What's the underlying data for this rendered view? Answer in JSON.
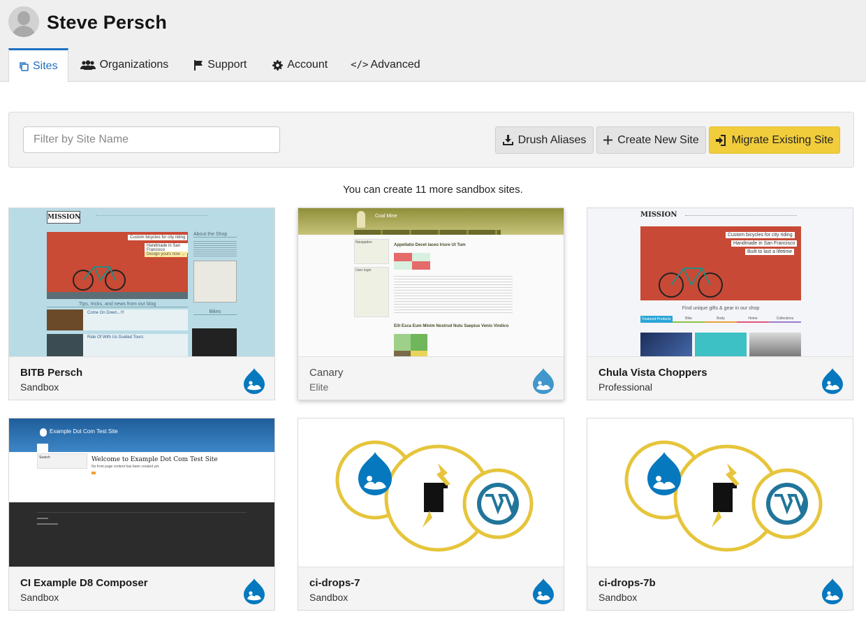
{
  "header": {
    "user_name": "Steve Persch",
    "tabs": [
      {
        "label": "Sites",
        "icon": "copy-icon",
        "active": true
      },
      {
        "label": "Organizations",
        "icon": "users-icon",
        "active": false
      },
      {
        "label": "Support",
        "icon": "flag-icon",
        "active": false
      },
      {
        "label": "Account",
        "icon": "gear-icon",
        "active": false
      },
      {
        "label": "Advanced",
        "icon": "code-icon",
        "active": false
      }
    ]
  },
  "toolbar": {
    "filter_placeholder": "Filter by Site Name",
    "filter_value": "",
    "drush_label": "Drush Aliases",
    "create_label": "Create New Site",
    "migrate_label": "Migrate Existing Site"
  },
  "sandbox_note": "You can create 11 more sandbox sites.",
  "colors": {
    "accent": "#1e6fbf",
    "migrate_button": "#f1cd3b",
    "drupal_blue": "#0678be",
    "migrate_ring": "#e6c53c"
  },
  "sites": [
    {
      "name": "BITB Persch",
      "plan": "Sandbox",
      "framework_icon": "drupal-icon"
    },
    {
      "name": "Canary",
      "plan": "Elite",
      "framework_icon": "drupal-icon"
    },
    {
      "name": "Chula Vista Choppers",
      "plan": "Professional",
      "framework_icon": "drupal-icon"
    },
    {
      "name": "CI Example D8 Composer",
      "plan": "Sandbox",
      "framework_icon": "drupal-icon"
    },
    {
      "name": "ci-drops-7",
      "plan": "Sandbox",
      "framework_icon": "drupal-icon"
    },
    {
      "name": "ci-drops-7b",
      "plan": "Sandbox",
      "framework_icon": "drupal-icon"
    }
  ],
  "thumbnails": {
    "bitb": {
      "logo": "MISSION",
      "caption_1": "Custom bicycles for city riding",
      "caption_2": "Handmade in San Francisco",
      "caption_3": "Design yours now →",
      "sidebar_heading": "About the Shop",
      "blog_heading": "Tips, tricks, and news from our blog",
      "post_1": "Come On Down...!!!",
      "post_2": "Ride Of With Us Guided Tours",
      "sidebar_heading_2": "Bikes"
    },
    "canary": {
      "site_name": "Coal Mine",
      "article_1": "Appellatio Decet Iaceo Iriure Ut Tum",
      "article_2": "Elit Esca Eum Minim Nostrud Nutu Saepius Venio Vindico",
      "nav_heading": "Navigation",
      "login_heading": "User login"
    },
    "chula": {
      "logo": "MISSION",
      "caption_1": "Custom bicycles for city riding",
      "caption_2": "Handmade in San Francisco",
      "caption_3": "Built to last a lifetime",
      "shop_line": "Find unique gifts & gear in our shop",
      "tabs": [
        "Featured Products",
        "Bike",
        "Body",
        "Home",
        "Collections"
      ]
    },
    "d8": {
      "site_name": "Example Dot Com Test Site",
      "welcome": "Welcome to Example Dot Com Test Site",
      "no_content": "No front page content has been created yet.",
      "search_label": "Search"
    }
  }
}
